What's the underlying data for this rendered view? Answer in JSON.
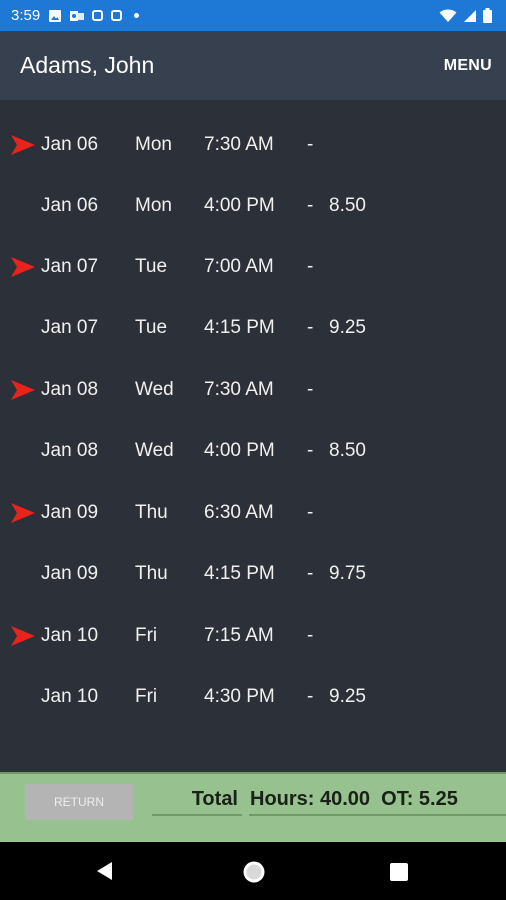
{
  "status_bar": {
    "time": "3:59",
    "left_icons": [
      "image-icon",
      "outlook-icon",
      "instagram-icon",
      "instagram-icon",
      "dot-icon"
    ],
    "right_icons": [
      "wifi-icon",
      "signal-icon",
      "battery-icon"
    ]
  },
  "header": {
    "title": "Adams, John",
    "menu_label": "MENU"
  },
  "entries": [
    {
      "date": "Jan 06",
      "day": "Mon",
      "time": "7:30 AM",
      "dash": "-",
      "hours": "",
      "punch_in": true
    },
    {
      "date": "Jan 06",
      "day": "Mon",
      "time": "4:00 PM",
      "dash": "-",
      "hours": "8.50",
      "punch_in": false
    },
    {
      "date": "Jan 07",
      "day": "Tue",
      "time": "7:00 AM",
      "dash": "-",
      "hours": "",
      "punch_in": true
    },
    {
      "date": "Jan 07",
      "day": "Tue",
      "time": "4:15 PM",
      "dash": "-",
      "hours": "9.25",
      "punch_in": false
    },
    {
      "date": "Jan 08",
      "day": "Wed",
      "time": "7:30 AM",
      "dash": "-",
      "hours": "",
      "punch_in": true
    },
    {
      "date": "Jan 08",
      "day": "Wed",
      "time": "4:00 PM",
      "dash": "-",
      "hours": "8.50",
      "punch_in": false
    },
    {
      "date": "Jan 09",
      "day": "Thu",
      "time": "6:30 AM",
      "dash": "-",
      "hours": "",
      "punch_in": true
    },
    {
      "date": "Jan 09",
      "day": "Thu",
      "time": "4:15 PM",
      "dash": "-",
      "hours": "9.75",
      "punch_in": false
    },
    {
      "date": "Jan 10",
      "day": "Fri",
      "time": "7:15 AM",
      "dash": "-",
      "hours": "",
      "punch_in": true
    },
    {
      "date": "Jan 10",
      "day": "Fri",
      "time": "4:30 PM",
      "dash": "-",
      "hours": "9.25",
      "punch_in": false
    }
  ],
  "footer": {
    "return_label": "RETURN",
    "total_label": "Total",
    "total_value": "Hours: 40.00  OT: 5.25"
  },
  "nav": {
    "back_icon": "back-icon",
    "home_icon": "home-icon",
    "recents_icon": "recents-icon"
  },
  "colors": {
    "status_bar": "#1e78d6",
    "app_bar": "#36404e",
    "background": "#2c3038",
    "arrow": "#e8231c",
    "footer": "#97c18f",
    "return_button": "#b4b4b4"
  }
}
